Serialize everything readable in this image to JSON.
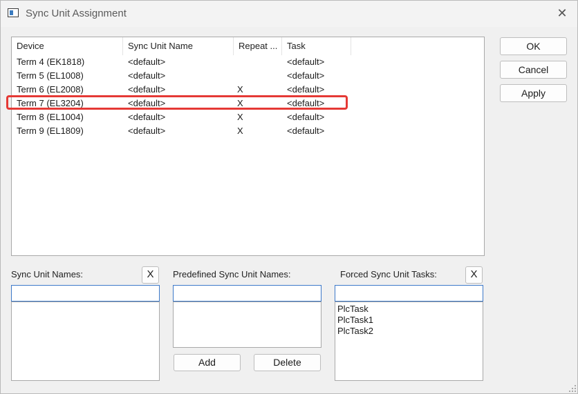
{
  "window": {
    "title": "Sync Unit Assignment",
    "close_glyph": "✕"
  },
  "table": {
    "columns": [
      "Device",
      "Sync Unit Name",
      "Repeat ...",
      "Task"
    ],
    "rows": [
      {
        "device": "Term 4 (EK1818)",
        "sync_unit_name": "<default>",
        "repeat": "",
        "task": "<default>"
      },
      {
        "device": "Term 5 (EL1008)",
        "sync_unit_name": "<default>",
        "repeat": "",
        "task": "<default>"
      },
      {
        "device": "Term 6 (EL2008)",
        "sync_unit_name": "<default>",
        "repeat": "X",
        "task": "<default>"
      },
      {
        "device": "Term 7 (EL3204)",
        "sync_unit_name": "<default>",
        "repeat": "X",
        "task": "<default>"
      },
      {
        "device": "Term 8 (EL1004)",
        "sync_unit_name": "<default>",
        "repeat": "X",
        "task": "<default>"
      },
      {
        "device": "Term 9 (EL1809)",
        "sync_unit_name": "<default>",
        "repeat": "X",
        "task": "<default>"
      }
    ],
    "highlight_color": "#e53935"
  },
  "buttons": {
    "ok": "OK",
    "cancel": "Cancel",
    "apply": "Apply",
    "add": "Add",
    "delete": "Delete",
    "clear_glyph": "X"
  },
  "sync_unit_names": {
    "label": "Sync Unit Names:",
    "input_value": "",
    "items": []
  },
  "predefined": {
    "label": "Predefined Sync Unit Names:",
    "input_value": "",
    "items": []
  },
  "forced_tasks": {
    "label": "Forced Sync Unit Tasks:",
    "input_value": "",
    "items": [
      "PlcTask",
      "PlcTask1",
      "PlcTask2"
    ]
  }
}
